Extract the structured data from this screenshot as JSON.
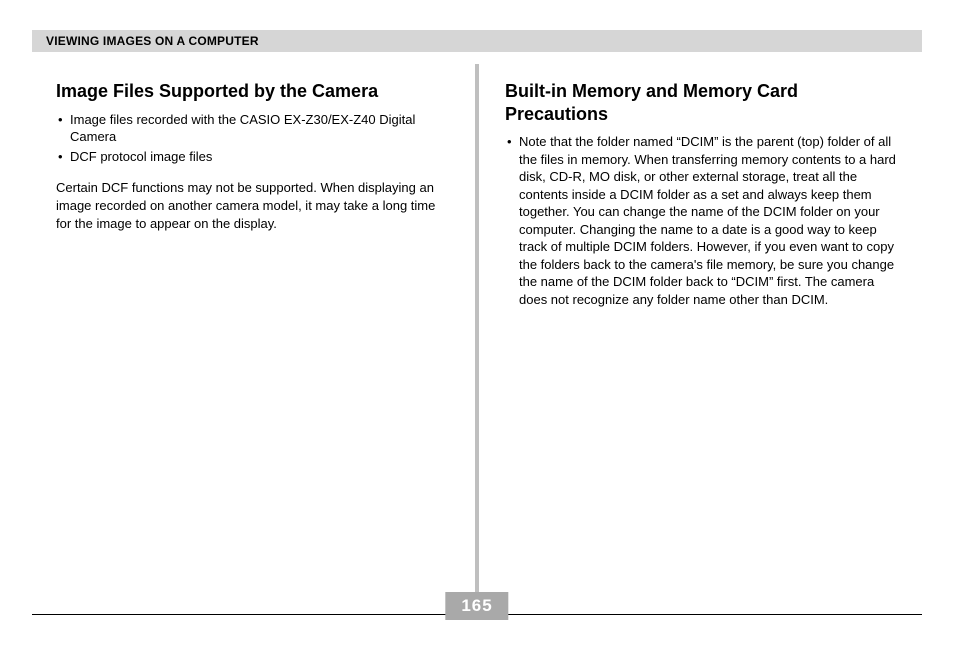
{
  "header": {
    "title": "VIEWING IMAGES ON A COMPUTER"
  },
  "left": {
    "heading": "Image Files Supported by the Camera",
    "bullets": [
      "Image files recorded with the CASIO EX-Z30/EX-Z40 Digital Camera",
      "DCF protocol image files"
    ],
    "paragraph": "Certain DCF functions may not be supported. When displaying an image recorded on another camera model, it may take a long time for the image to appear on the display."
  },
  "right": {
    "heading": "Built-in Memory and Memory Card Precautions",
    "bullets": [
      "Note that the folder named “DCIM” is the parent (top) folder of all the files in memory. When transferring memory contents to a hard disk, CD-R, MO disk, or other external storage, treat all the contents inside a DCIM folder as a set and always keep them together. You can change the name of the DCIM folder on your computer. Changing the name to a date is a good way to keep track of multiple DCIM folders. However, if you even want to copy the folders back to the camera's file memory, be sure you change the name of the DCIM folder back to “DCIM” first. The camera does not recognize any folder name other than DCIM."
    ]
  },
  "page_number": "165"
}
